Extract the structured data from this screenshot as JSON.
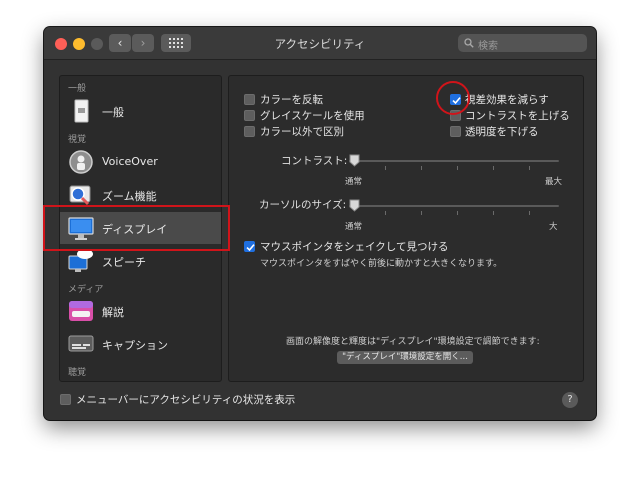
{
  "window": {
    "title": "アクセシビリティ",
    "search_placeholder": "検索",
    "help_label": "?"
  },
  "sidebar": {
    "sections": [
      "一般",
      "視覚",
      "メディア",
      "聴覚"
    ],
    "items": [
      {
        "label": "一般",
        "icon": "general-icon"
      },
      {
        "label": "VoiceOver",
        "icon": "voiceover-icon"
      },
      {
        "label": "ズーム機能",
        "icon": "zoom-icon"
      },
      {
        "label": "ディスプレイ",
        "icon": "display-icon",
        "selected": true
      },
      {
        "label": "スピーチ",
        "icon": "speech-icon"
      },
      {
        "label": "解説",
        "icon": "descriptions-icon"
      },
      {
        "label": "キャプション",
        "icon": "captions-icon"
      }
    ]
  },
  "display": {
    "checkboxes": [
      {
        "label": "カラーを反転",
        "checked": false
      },
      {
        "label": "グレイスケールを使用",
        "checked": false
      },
      {
        "label": "カラー以外で区別",
        "checked": false
      },
      {
        "label": "視差効果を減らす",
        "checked": true
      },
      {
        "label": "コントラストを上げる",
        "checked": false
      },
      {
        "label": "透明度を下げる",
        "checked": false
      }
    ],
    "contrast": {
      "label": "コントラスト:",
      "min": "通常",
      "max": "最大",
      "value": 0
    },
    "cursor_size": {
      "label": "カーソルのサイズ:",
      "min": "通常",
      "max": "大",
      "value": 0
    },
    "shake": {
      "label": "マウスポインタをシェイクして見つける",
      "description": "マウスポインタをすばやく前後に動かすと大きくなります。",
      "checked": true
    },
    "note": "画面の解像度と輝度は\"ディスプレイ\"環境設定で調節できます:",
    "open_button": "\"ディスプレイ\"環境設定を開く..."
  },
  "footer": {
    "menubar_status_label": "メニューバーにアクセシビリティの状況を表示",
    "checked": false
  },
  "colors": {
    "accent": "#1f6fe0",
    "highlight": "#d0141a",
    "window_bg": "#323232"
  }
}
